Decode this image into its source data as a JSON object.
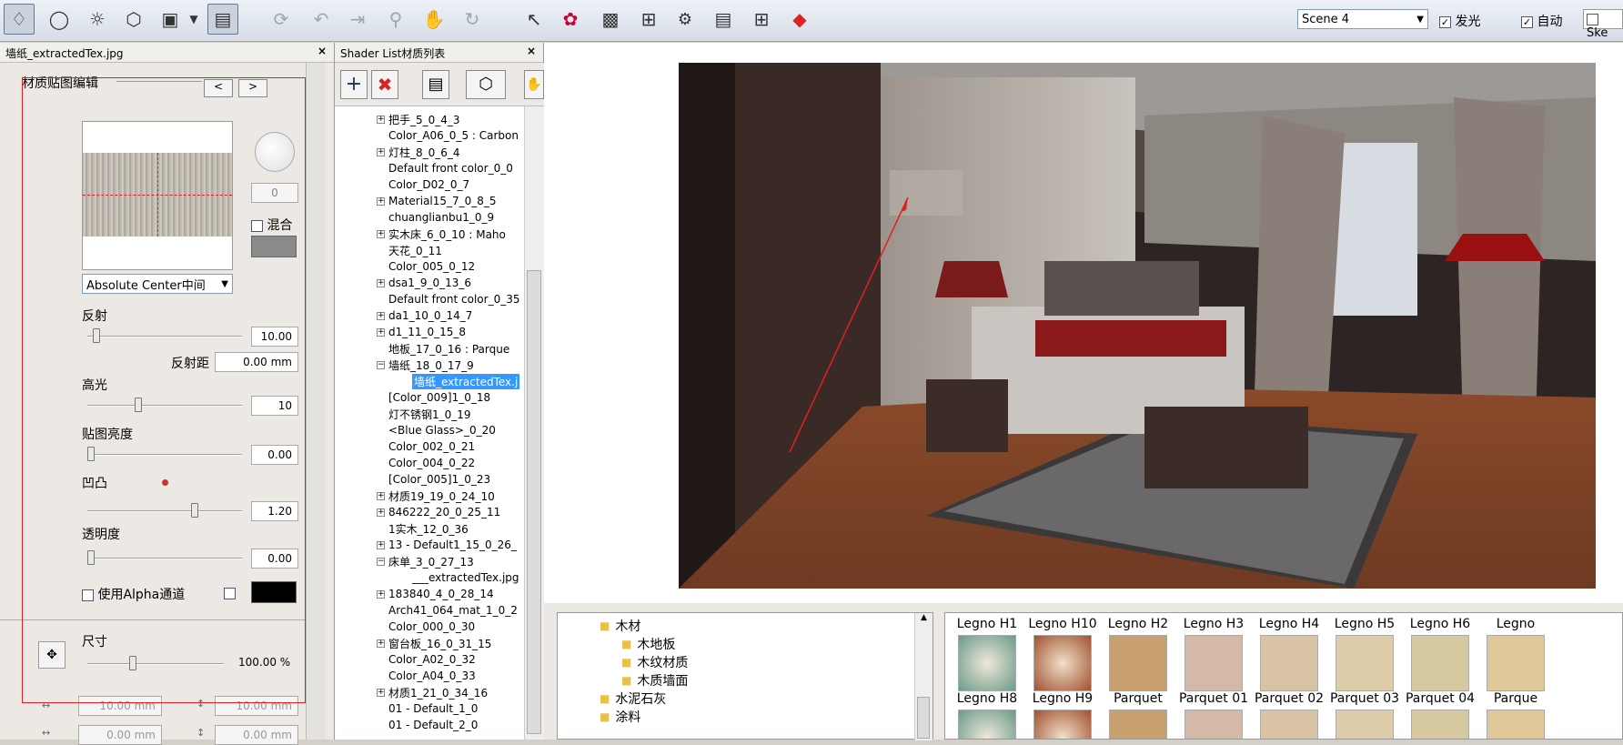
{
  "toolbar": {
    "scene_select": "Scene 4",
    "glow_label": "发光",
    "auto_label": "自动",
    "sky_label": "Ske",
    "icons": [
      "paint-bucket-icon",
      "bulb-icon",
      "sun-icon",
      "cube-icon",
      "camera-icon",
      "dropdown-icon",
      "panel-icon",
      "orbit-icon",
      "undo-icon",
      "export-icon",
      "zoom-icon",
      "hand-icon",
      "refresh-icon",
      "axis-icon",
      "palette-icon",
      "photo-icon",
      "crop-icon",
      "gear-icon",
      "window-icon",
      "add-view-icon",
      "render-icon"
    ]
  },
  "editor": {
    "title": "墙纸_extractedTex.jpg",
    "section": "材质贴图编辑",
    "prev": "<",
    "next": ">",
    "value_small": "0",
    "blend_label": "混合",
    "mapping": "Absolute Center中间",
    "reflect_label": "反射",
    "reflect_value": "10.00",
    "reflect_dist_label": "反射距",
    "reflect_dist_value": "0.00 mm",
    "highlight_label": "高光",
    "highlight_value": "10",
    "brightness_label": "贴图亮度",
    "brightness_value": "0.00",
    "bump_label": "凹凸",
    "bump_value": "1.20",
    "opacity_label": "透明度",
    "opacity_value": "0.00",
    "alpha_label": "使用Alpha通道",
    "size_label": "尺寸",
    "size_value": "100.00 %",
    "w_value": "10.00 mm",
    "h_value": "10.00 mm",
    "x_value": "0.00 mm",
    "y_value": "0.00 mm"
  },
  "shader": {
    "title": "Shader List材质列表",
    "items": [
      {
        "label": "把手_5_0_4_3",
        "exp": "plus"
      },
      {
        "label": "Color_A06_0_5 : Carbon",
        "exp": ""
      },
      {
        "label": "灯柱_8_0_6_4",
        "exp": "plus"
      },
      {
        "label": "Default front color_0_0",
        "exp": ""
      },
      {
        "label": "Color_D02_0_7",
        "exp": ""
      },
      {
        "label": "Material15_7_0_8_5",
        "exp": "plus"
      },
      {
        "label": "chuanglianbu1_0_9",
        "exp": ""
      },
      {
        "label": "实木床_6_0_10 : Maho",
        "exp": "plus"
      },
      {
        "label": "天花_0_11",
        "exp": ""
      },
      {
        "label": "Color_005_0_12",
        "exp": ""
      },
      {
        "label": "dsa1_9_0_13_6",
        "exp": "plus"
      },
      {
        "label": "Default front color_0_35",
        "exp": ""
      },
      {
        "label": "da1_10_0_14_7",
        "exp": "plus"
      },
      {
        "label": "d1_11_0_15_8",
        "exp": "plus"
      },
      {
        "label": "地板_17_0_16 : Parque",
        "exp": ""
      },
      {
        "label": "墙纸_18_0_17_9",
        "exp": "minus"
      },
      {
        "label": "墙纸_extractedTex.j",
        "exp": "child-sel"
      },
      {
        "label": "[Color_009]1_0_18",
        "exp": ""
      },
      {
        "label": "灯不锈钢1_0_19",
        "exp": ""
      },
      {
        "label": "<Blue Glass>_0_20",
        "exp": ""
      },
      {
        "label": "Color_002_0_21",
        "exp": ""
      },
      {
        "label": "Color_004_0_22",
        "exp": ""
      },
      {
        "label": "[Color_005]1_0_23",
        "exp": ""
      },
      {
        "label": "材质19_19_0_24_10",
        "exp": "plus"
      },
      {
        "label": "846222_20_0_25_11",
        "exp": "plus"
      },
      {
        "label": "1实木_12_0_36",
        "exp": ""
      },
      {
        "label": "13 - Default1_15_0_26_",
        "exp": "plus"
      },
      {
        "label": "床单_3_0_27_13",
        "exp": "minus"
      },
      {
        "label": "___extractedTex.jpg",
        "exp": "child"
      },
      {
        "label": "183840_4_0_28_14",
        "exp": "plus"
      },
      {
        "label": "Arch41_064_mat_1_0_2",
        "exp": ""
      },
      {
        "label": "Color_000_0_30",
        "exp": ""
      },
      {
        "label": "窗台板_16_0_31_15",
        "exp": "plus"
      },
      {
        "label": "Color_A02_0_32",
        "exp": ""
      },
      {
        "label": "Color_A04_0_33",
        "exp": ""
      },
      {
        "label": "材质1_21_0_34_16",
        "exp": "plus"
      },
      {
        "label": "01 - Default_1_0",
        "exp": ""
      },
      {
        "label": "01 - Default_2_0",
        "exp": ""
      }
    ]
  },
  "library": {
    "folders": [
      {
        "label": "木材",
        "level": 0
      },
      {
        "label": "木地板",
        "level": 1
      },
      {
        "label": "木纹材质",
        "level": 1
      },
      {
        "label": "木质墙面",
        "level": 1
      },
      {
        "label": "水泥石灰",
        "level": 0
      },
      {
        "label": "涂料",
        "level": 0
      }
    ],
    "thumbs_row1": [
      "Legno H1",
      "Legno H10",
      "Legno H2",
      "Legno H3",
      "Legno H4",
      "Legno H5",
      "Legno H6",
      "Legno"
    ],
    "thumbs_row2": [
      "Legno H8",
      "Legno H9",
      "Parquet",
      "Parquet 01",
      "Parquet 02",
      "Parquet 03",
      "Parquet 04",
      "Parque"
    ]
  },
  "colors": {
    "accent": "#3399ff",
    "annotation": "#e02020"
  }
}
